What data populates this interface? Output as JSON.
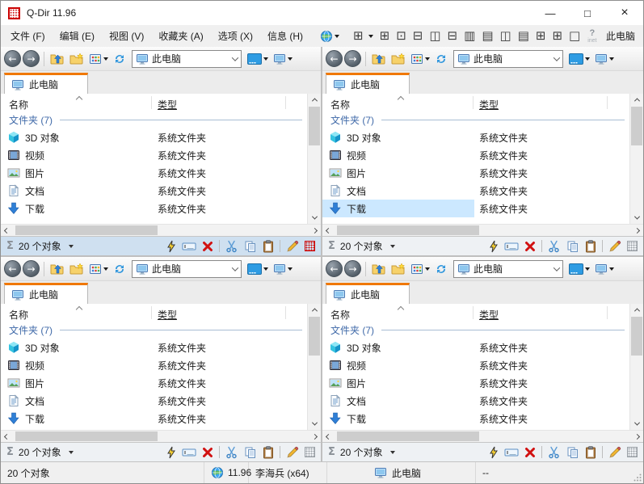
{
  "window": {
    "title": "Q-Dir 11.96",
    "minimize": "—",
    "maximize": "□",
    "close": "×"
  },
  "menu": {
    "items": [
      {
        "label": "文件 (F)"
      },
      {
        "label": "编辑 (E)"
      },
      {
        "label": "视图 (V)"
      },
      {
        "label": "收藏夹 (A)"
      },
      {
        "label": "选项 (X)"
      },
      {
        "label": "信息 (H)"
      }
    ],
    "layout_main_glyph": "⊞",
    "layout_icons": [
      {
        "glyph": "⊞"
      },
      {
        "glyph": "⊡"
      },
      {
        "glyph": "⊟"
      },
      {
        "glyph": "◫"
      },
      {
        "glyph": "⊟"
      },
      {
        "glyph": "▥"
      },
      {
        "glyph": "▤"
      },
      {
        "glyph": "◫"
      },
      {
        "glyph": "▤"
      },
      {
        "glyph": "⊞"
      },
      {
        "glyph": "⊞"
      },
      {
        "glyph": "□"
      }
    ],
    "inet_question": "?",
    "inet_label": "inet",
    "current_path_label": "此电脑"
  },
  "panes": [
    {
      "address": "此电脑",
      "tab": "此电脑",
      "col_name": "名称",
      "col_type": "类型",
      "group": "文件夹 (7)",
      "status_count": "20 个对象",
      "active": true,
      "selected": null,
      "items": [
        {
          "name": "3D 对象",
          "type": "系统文件夹",
          "icon": "cube-icon"
        },
        {
          "name": "视频",
          "type": "系统文件夹",
          "icon": "film-icon"
        },
        {
          "name": "图片",
          "type": "系统文件夹",
          "icon": "picture-icon"
        },
        {
          "name": "文档",
          "type": "系统文件夹",
          "icon": "document-icon"
        },
        {
          "name": "下载",
          "type": "系统文件夹",
          "icon": "download-icon"
        }
      ]
    },
    {
      "address": "此电脑",
      "tab": "此电脑",
      "col_name": "名称",
      "col_type": "类型",
      "group": "文件夹 (7)",
      "status_count": "20 个对象",
      "active": false,
      "selected": "下载",
      "items": [
        {
          "name": "3D 对象",
          "type": "系统文件夹",
          "icon": "cube-icon"
        },
        {
          "name": "视频",
          "type": "系统文件夹",
          "icon": "film-icon"
        },
        {
          "name": "图片",
          "type": "系统文件夹",
          "icon": "picture-icon"
        },
        {
          "name": "文档",
          "type": "系统文件夹",
          "icon": "document-icon"
        },
        {
          "name": "下载",
          "type": "系统文件夹",
          "icon": "download-icon"
        }
      ]
    },
    {
      "address": "此电脑",
      "tab": "此电脑",
      "col_name": "名称",
      "col_type": "类型",
      "group": "文件夹 (7)",
      "status_count": "20 个对象",
      "active": false,
      "selected": null,
      "items": [
        {
          "name": "3D 对象",
          "type": "系统文件夹",
          "icon": "cube-icon"
        },
        {
          "name": "视频",
          "type": "系统文件夹",
          "icon": "film-icon"
        },
        {
          "name": "图片",
          "type": "系统文件夹",
          "icon": "picture-icon"
        },
        {
          "name": "文档",
          "type": "系统文件夹",
          "icon": "document-icon"
        },
        {
          "name": "下载",
          "type": "系统文件夹",
          "icon": "download-icon"
        }
      ]
    },
    {
      "address": "此电脑",
      "tab": "此电脑",
      "col_name": "名称",
      "col_type": "类型",
      "group": "文件夹 (7)",
      "status_count": "20 个对象",
      "active": false,
      "selected": null,
      "items": [
        {
          "name": "3D 对象",
          "type": "系统文件夹",
          "icon": "cube-icon"
        },
        {
          "name": "视频",
          "type": "系统文件夹",
          "icon": "film-icon"
        },
        {
          "name": "图片",
          "type": "系统文件夹",
          "icon": "picture-icon"
        },
        {
          "name": "文档",
          "type": "系统文件夹",
          "icon": "document-icon"
        },
        {
          "name": "下载",
          "type": "系统文件夹",
          "icon": "download-icon"
        }
      ]
    }
  ],
  "statusbar": {
    "objects": "20 个对象",
    "version": "11.96",
    "user": "李海兵 (x64)",
    "location": "此电脑",
    "extra": "--"
  },
  "colors": {
    "tab_accent": "#f07800",
    "selection": "#cce8ff",
    "active_status_bg": "#cfe0f0",
    "group_text": "#3f69a8",
    "delete_red": "#d11111",
    "logo_red": "#cc0000"
  }
}
